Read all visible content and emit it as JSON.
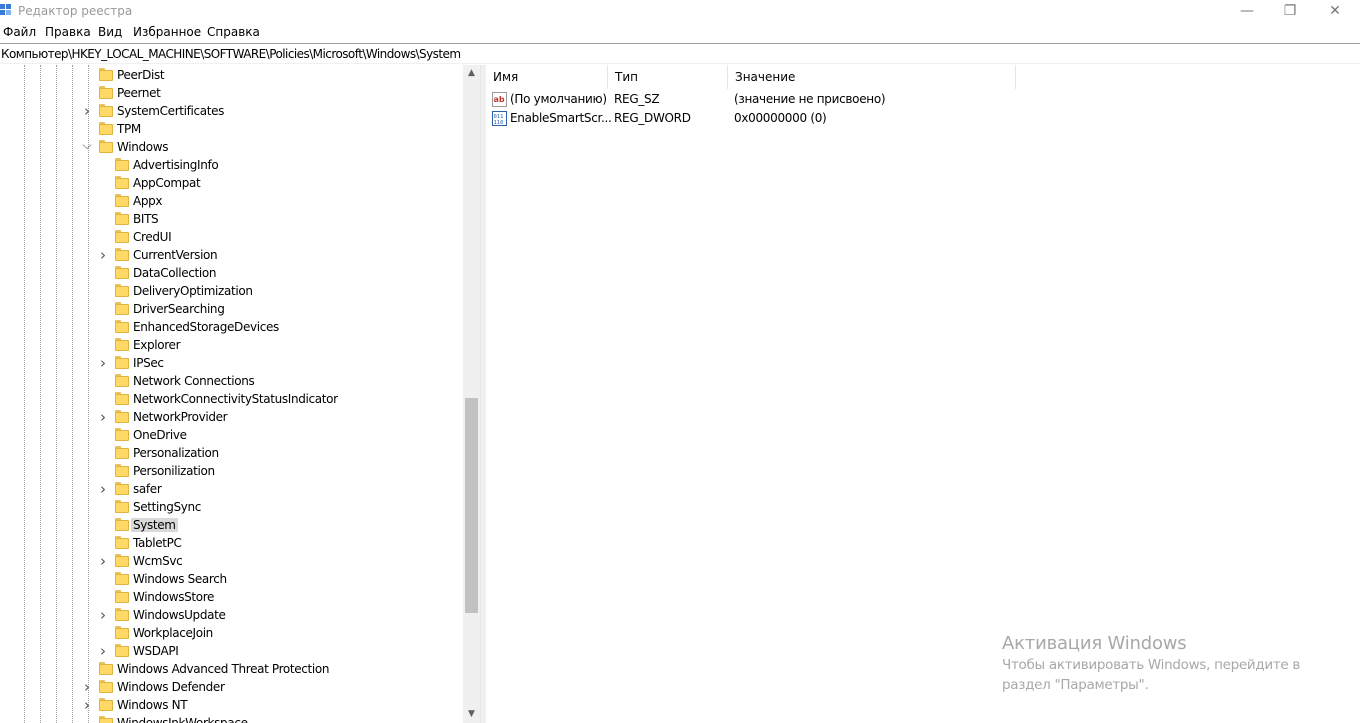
{
  "window": {
    "title": "Редактор реестра",
    "minimize_glyph": "—",
    "maximize_glyph": "❐",
    "close_glyph": "✕"
  },
  "menu": [
    "Файл",
    "Правка",
    "Вид",
    "Избранное",
    "Справка"
  ],
  "address": "Компьютер\\HKEY_LOCAL_MACHINE\\SOFTWARE\\Policies\\Microsoft\\Windows\\System",
  "tree": [
    {
      "label": "PeerDist",
      "level": 1,
      "expander": "none",
      "icon": "folder-icon"
    },
    {
      "label": "Peernet",
      "level": 1,
      "expander": "none",
      "icon": "folder-icon"
    },
    {
      "label": "SystemCertificates",
      "level": 1,
      "expander": "collapsed",
      "icon": "folder-icon"
    },
    {
      "label": "TPM",
      "level": 1,
      "expander": "none",
      "icon": "folder-icon"
    },
    {
      "label": "Windows",
      "level": 1,
      "expander": "expanded",
      "icon": "folder-icon"
    },
    {
      "label": "AdvertisingInfo",
      "level": 2,
      "expander": "none",
      "icon": "folder-icon"
    },
    {
      "label": "AppCompat",
      "level": 2,
      "expander": "none",
      "icon": "folder-icon"
    },
    {
      "label": "Appx",
      "level": 2,
      "expander": "none",
      "icon": "folder-icon"
    },
    {
      "label": "BITS",
      "level": 2,
      "expander": "none",
      "icon": "folder-icon"
    },
    {
      "label": "CredUI",
      "level": 2,
      "expander": "none",
      "icon": "folder-icon"
    },
    {
      "label": "CurrentVersion",
      "level": 2,
      "expander": "collapsed",
      "icon": "folder-icon"
    },
    {
      "label": "DataCollection",
      "level": 2,
      "expander": "none",
      "icon": "folder-icon"
    },
    {
      "label": "DeliveryOptimization",
      "level": 2,
      "expander": "none",
      "icon": "folder-icon"
    },
    {
      "label": "DriverSearching",
      "level": 2,
      "expander": "none",
      "icon": "folder-icon"
    },
    {
      "label": "EnhancedStorageDevices",
      "level": 2,
      "expander": "none",
      "icon": "folder-icon"
    },
    {
      "label": "Explorer",
      "level": 2,
      "expander": "none",
      "icon": "folder-icon"
    },
    {
      "label": "IPSec",
      "level": 2,
      "expander": "collapsed",
      "icon": "folder-icon"
    },
    {
      "label": "Network Connections",
      "level": 2,
      "expander": "none",
      "icon": "folder-icon"
    },
    {
      "label": "NetworkConnectivityStatusIndicator",
      "level": 2,
      "expander": "none",
      "icon": "folder-icon"
    },
    {
      "label": "NetworkProvider",
      "level": 2,
      "expander": "collapsed",
      "icon": "folder-icon"
    },
    {
      "label": "OneDrive",
      "level": 2,
      "expander": "none",
      "icon": "folder-icon"
    },
    {
      "label": "Personalization",
      "level": 2,
      "expander": "none",
      "icon": "folder-icon"
    },
    {
      "label": "Personilization",
      "level": 2,
      "expander": "none",
      "icon": "folder-icon"
    },
    {
      "label": "safer",
      "level": 2,
      "expander": "collapsed",
      "icon": "folder-icon"
    },
    {
      "label": "SettingSync",
      "level": 2,
      "expander": "none",
      "icon": "folder-icon"
    },
    {
      "label": "System",
      "level": 2,
      "expander": "none",
      "icon": "folder-icon",
      "selected": true
    },
    {
      "label": "TabletPC",
      "level": 2,
      "expander": "none",
      "icon": "folder-icon"
    },
    {
      "label": "WcmSvc",
      "level": 2,
      "expander": "collapsed",
      "icon": "folder-icon"
    },
    {
      "label": "Windows Search",
      "level": 2,
      "expander": "none",
      "icon": "folder-icon"
    },
    {
      "label": "WindowsStore",
      "level": 2,
      "expander": "none",
      "icon": "folder-icon"
    },
    {
      "label": "WindowsUpdate",
      "level": 2,
      "expander": "collapsed",
      "icon": "folder-icon"
    },
    {
      "label": "WorkplaceJoin",
      "level": 2,
      "expander": "none",
      "icon": "folder-icon"
    },
    {
      "label": "WSDAPI",
      "level": 2,
      "expander": "collapsed",
      "icon": "folder-icon"
    },
    {
      "label": "Windows Advanced Threat Protection",
      "level": 1,
      "expander": "none",
      "icon": "folder-icon"
    },
    {
      "label": "Windows Defender",
      "level": 1,
      "expander": "collapsed",
      "icon": "folder-icon"
    },
    {
      "label": "Windows NT",
      "level": 1,
      "expander": "collapsed",
      "icon": "folder-icon"
    },
    {
      "label": "WindowsInkWorkspace",
      "level": 1,
      "expander": "none",
      "icon": "folder-icon"
    }
  ],
  "list": {
    "columns": [
      "Имя",
      "Тип",
      "Значение"
    ],
    "rows": [
      {
        "name": "(По умолчанию)",
        "type": "REG_SZ",
        "value": "(значение не присвоено)",
        "icon": "string-value-icon"
      },
      {
        "name": "EnableSmartScr...",
        "type": "REG_DWORD",
        "value": "0x00000000 (0)",
        "icon": "dword-value-icon"
      }
    ]
  },
  "watermark": {
    "title": "Активация Windows",
    "line1": "Чтобы активировать Windows, перейдите в",
    "line2": "раздел \"Параметры\"."
  },
  "colors": {
    "folder": "#ffd966",
    "selection": "#d9d9d9",
    "watermark": "#a8a8a8"
  }
}
